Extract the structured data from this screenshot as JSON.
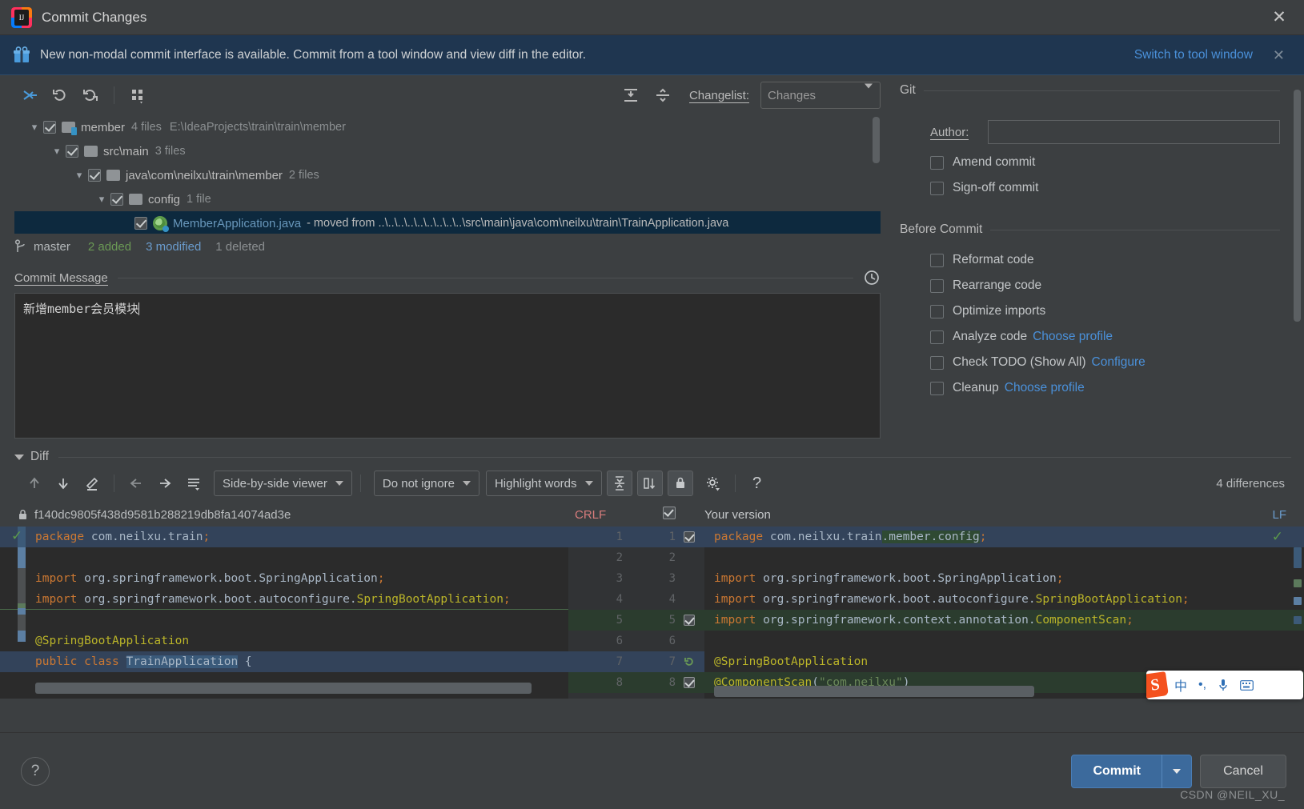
{
  "window": {
    "title": "Commit Changes",
    "close_icon": "close-icon",
    "logo_letters": "IJ"
  },
  "banner": {
    "icon": "gift-icon",
    "text": "New non-modal commit interface is available. Commit from a tool window and view diff in the editor.",
    "link": "Switch to tool window",
    "close_icon": "close-icon"
  },
  "toolbar": {
    "buttons": [
      {
        "name": "show-diff-icon",
        "glyph": "⇥"
      },
      {
        "name": "revert-icon",
        "glyph": "↶"
      },
      {
        "name": "refresh-icon",
        "glyph": "↻"
      },
      {
        "name": "group-by-icon",
        "glyph": "∷"
      }
    ],
    "expand_all_icon": "expand-all-icon",
    "collapse_all_icon": "collapse-all-icon",
    "changelist_label": "Changelist:",
    "changelist_value": "Changes"
  },
  "tree": {
    "rows": [
      {
        "indent": 0,
        "expanded": true,
        "checked": true,
        "icon": "folder-module-icon",
        "name": "member",
        "meta": "4 files",
        "path": "E:\\IdeaProjects\\train\\train\\member",
        "selected": false
      },
      {
        "indent": 1,
        "expanded": true,
        "checked": true,
        "icon": "folder-icon",
        "name": "src\\main",
        "meta": "3 files",
        "path": "",
        "selected": false
      },
      {
        "indent": 2,
        "expanded": true,
        "checked": true,
        "icon": "folder-icon",
        "name": "java\\com\\neilxu\\train\\member",
        "meta": "2 files",
        "path": "",
        "selected": false
      },
      {
        "indent": 3,
        "expanded": true,
        "checked": true,
        "icon": "folder-icon",
        "name": "config",
        "meta": "1 file",
        "path": "",
        "selected": false
      },
      {
        "indent": 4,
        "expanded": false,
        "checked": true,
        "icon": "java-class-icon",
        "name": "MemberApplication.java",
        "meta": "",
        "moved": "- moved from ..\\..\\..\\..\\..\\..\\..\\..\\..\\src\\main\\java\\com\\neilxu\\train\\TrainApplication.java",
        "selected": true
      }
    ]
  },
  "status": {
    "branch_icon": "branch-icon",
    "branch": "master",
    "added": "2 added",
    "modified": "3 modified",
    "deleted": "1 deleted"
  },
  "commit_message": {
    "label": "Commit Message",
    "history_icon": "clock-icon",
    "value": "新增member会员模块"
  },
  "git_section": {
    "title": "Git",
    "author_label": "Author:",
    "author_value": "",
    "checkboxes": [
      {
        "label": "Amend commit",
        "checked": false,
        "mnemonic": "m"
      },
      {
        "label": "Sign-off commit",
        "checked": false,
        "mnemonic": "g"
      }
    ]
  },
  "before_commit": {
    "title": "Before Commit",
    "checkboxes": [
      {
        "label": "Reformat code",
        "checked": false,
        "link": ""
      },
      {
        "label": "Rearrange code",
        "checked": false,
        "link": ""
      },
      {
        "label": "Optimize imports",
        "checked": false,
        "link": ""
      },
      {
        "label": "Analyze code",
        "checked": false,
        "link": "Choose profile"
      },
      {
        "label": "Check TODO (Show All)",
        "checked": false,
        "link": "Configure"
      },
      {
        "label": "Cleanup",
        "checked": false,
        "link": "Choose profile"
      }
    ]
  },
  "diff": {
    "section_label": "Diff",
    "toolbar": {
      "prev_diff_icon": "arrow-up-icon",
      "next_diff_icon": "arrow-down-icon",
      "edit_icon": "pencil-icon",
      "accept_left_icon": "arrow-left-icon",
      "accept_right_icon": "arrow-right-icon",
      "lines_icon": "list-icon",
      "viewer_mode": "Side-by-side viewer",
      "ignore_mode": "Do not ignore",
      "highlight_mode": "Highlight words",
      "collapse_unchanged_icon": "collapse-unchanged-icon",
      "sync_scroll_icon": "sync-scroll-icon",
      "readonly_icon": "lock-icon",
      "settings_icon": "gear-icon",
      "help_icon": "question-icon",
      "differences_count": "4 differences"
    },
    "left_header": {
      "lock_icon": "lock-icon",
      "revision": "f140dc9805f438d9581b288219db8fa14074ad3e",
      "line_separator": "CRLF"
    },
    "right_header": {
      "title": "Your version",
      "line_separator": "LF",
      "checkbox_checked": true
    },
    "left_lines": [
      {
        "num": "1",
        "html": "<span class=\"kw\">package</span> com.neilxu.train<span class=\"semi\">;</span>",
        "state": "changed"
      },
      {
        "num": "2",
        "html": "",
        "state": "same"
      },
      {
        "num": "3",
        "html": "<span class=\"kw\">import</span> org.springframework.boot.SpringApplication<span class=\"semi\">;</span>",
        "state": "same"
      },
      {
        "num": "4",
        "html": "<span class=\"kw\">import</span> org.springframework.boot.autoconfigure.<span class=\"ann\">SpringBootApplication</span><span class=\"semi\">;</span>",
        "state": "same"
      },
      {
        "num": "5",
        "html": "",
        "state": "inserted"
      },
      {
        "num": "6",
        "html": "<span class=\"ann\">@SpringBootApplication</span>",
        "state": "same"
      },
      {
        "num": "7",
        "html": "<span class=\"kw\">public class</span> <span class=\"hl-blue\">TrainApplication</span> {",
        "state": "changed"
      },
      {
        "num": "8",
        "html": "",
        "state": "same"
      }
    ],
    "right_lines": [
      {
        "num": "1",
        "html": "<span class=\"kw\">package</span> com.neilxu.train<span class=\"hl-green\">.member.config</span><span class=\"semi\">;</span>",
        "state": "changed"
      },
      {
        "num": "2",
        "html": "",
        "state": "same"
      },
      {
        "num": "3",
        "html": "<span class=\"kw\">import</span> org.springframework.boot.SpringApplication<span class=\"semi\">;</span>",
        "state": "same"
      },
      {
        "num": "4",
        "html": "<span class=\"kw\">import</span> org.springframework.boot.autoconfigure.<span class=\"ann\">SpringBootApplication</span><span class=\"semi\">;</span>",
        "state": "same"
      },
      {
        "num": "5",
        "html": "<span class=\"kw\">import</span> org.springframework.context.annotation.<span class=\"ann\">ComponentScan</span><span class=\"semi\">;</span>",
        "state": "inserted"
      },
      {
        "num": "6",
        "html": "",
        "state": "same"
      },
      {
        "num": "7",
        "html": "<span class=\"ann\">@SpringBootApplication</span>",
        "state": "same"
      },
      {
        "num": "8",
        "html": "<span class=\"ann\">@ComponentScan</span>(<span class=\"str\">\"com.neilxu\"</span>)",
        "state": "inserted"
      }
    ]
  },
  "footer": {
    "help_icon": "question-icon",
    "commit_label": "Commit",
    "commit_dropdown_icon": "chevron-down-icon",
    "cancel_label": "Cancel",
    "watermark": "CSDN @NEIL_XU_"
  },
  "ime": {
    "logo": "sogou-logo",
    "items": [
      "中",
      "•,",
      "🎙",
      "⌨"
    ]
  }
}
